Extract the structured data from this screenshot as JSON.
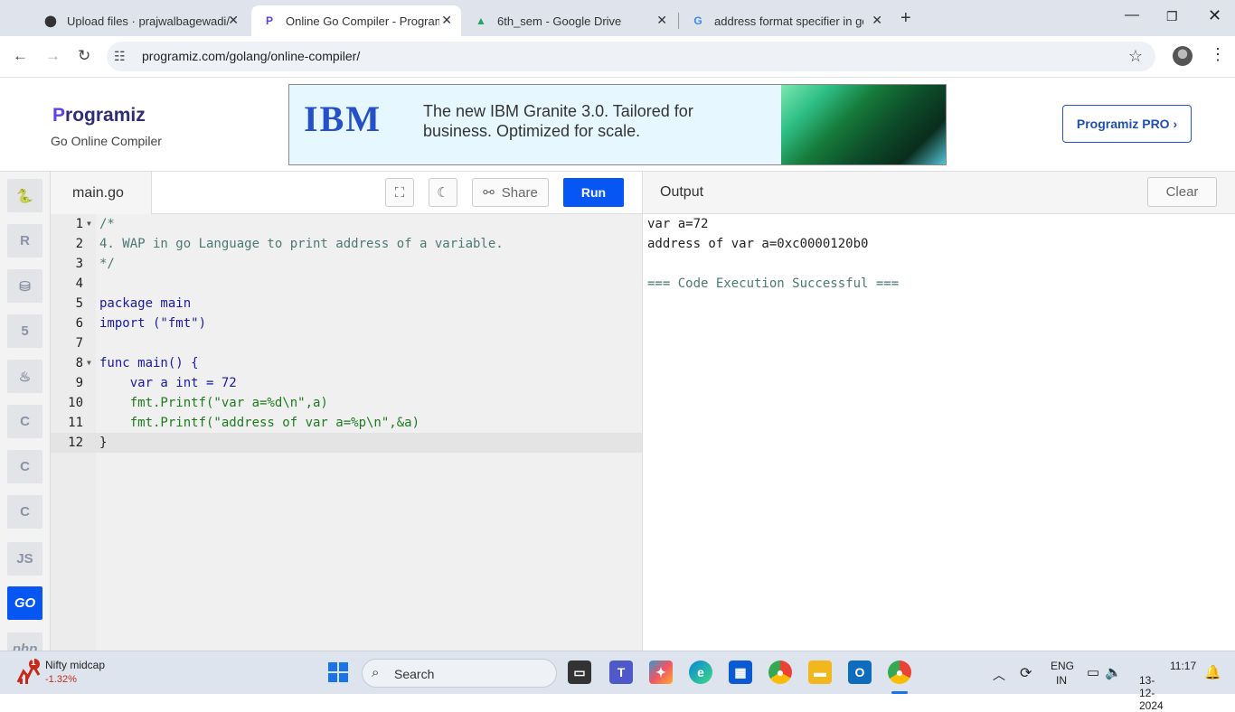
{
  "browser": {
    "tabs": [
      {
        "title": "Upload files · prajwalbagewadi/",
        "icon": "github-icon",
        "active": false
      },
      {
        "title": "Online Go Compiler - Programiz",
        "icon": "programiz-icon",
        "active": true
      },
      {
        "title": "6th_sem - Google Drive",
        "icon": "google-drive-icon",
        "active": false
      },
      {
        "title": "address format specifier in go -",
        "icon": "google-icon",
        "active": false
      }
    ],
    "url": "programiz.com/golang/online-compiler/"
  },
  "header": {
    "logo": "rogramiz",
    "logo_p": "P",
    "subtitle": "Go Online Compiler",
    "ad_brand": "IBM",
    "ad_text": "The new IBM Granite 3.0. Tailored for business. Optimized for scale.",
    "pro_button": "Programiz PRO ›"
  },
  "sidebar": {
    "languages": [
      {
        "name": "python-icon",
        "label": "🐍"
      },
      {
        "name": "r-icon",
        "label": "R"
      },
      {
        "name": "sql-icon",
        "label": "⛁"
      },
      {
        "name": "html5-icon",
        "label": "5"
      },
      {
        "name": "java-icon",
        "label": "♨"
      },
      {
        "name": "c-icon",
        "label": "C"
      },
      {
        "name": "cpp-icon",
        "label": "C"
      },
      {
        "name": "csharp-icon",
        "label": "C"
      },
      {
        "name": "js-icon",
        "label": "JS"
      },
      {
        "name": "go-icon",
        "label": "GO",
        "active": true
      },
      {
        "name": "php-icon",
        "label": "php"
      }
    ]
  },
  "editor": {
    "filename": "main.go",
    "share_label": "Share",
    "run_label": "Run",
    "lines": [
      "/*",
      "4. WAP in go Language to print address of a variable.",
      "*/",
      "",
      "package main",
      "import (\"fmt\")",
      "",
      "func main() {",
      "    var a int = 72",
      "    fmt.Printf(\"var a=%d\\n\",a)",
      "    fmt.Printf(\"address of var a=%p\\n\",&a)",
      "}"
    ]
  },
  "output": {
    "title": "Output",
    "clear_label": "Clear",
    "lines": [
      "var a=72",
      "address of var a=0xc0000120b0",
      "",
      "=== Code Execution Successful ==="
    ]
  },
  "taskbar": {
    "stock_name": "Nifty midcap",
    "stock_change": "-1.32%",
    "stock_badge": "1",
    "search_label": "Search",
    "lang_top": "ENG",
    "lang_bottom": "IN",
    "time": "11:17",
    "date": "13-12-2024"
  }
}
